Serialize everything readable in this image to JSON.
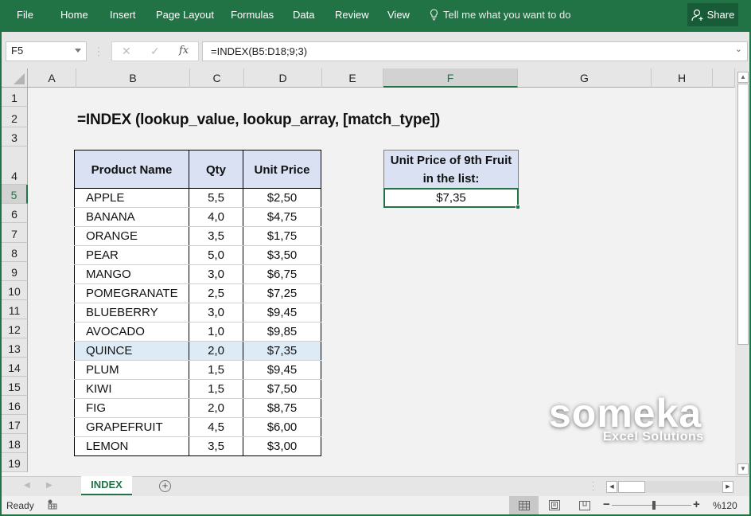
{
  "ribbon": {
    "tabs": [
      "File",
      "Home",
      "Insert",
      "Page Layout",
      "Formulas",
      "Data",
      "Review",
      "View"
    ],
    "tell_me": "Tell me what you want to do",
    "share": "Share"
  },
  "formula_bar": {
    "name_box": "F5",
    "formula": "=INDEX(B5:D18;9;3)"
  },
  "columns": [
    "A",
    "B",
    "C",
    "D",
    "E",
    "F",
    "G",
    "H"
  ],
  "selected_column": "F",
  "rows": [
    "1",
    "2",
    "3",
    "4",
    "5",
    "6",
    "7",
    "8",
    "9",
    "10",
    "11",
    "12",
    "13",
    "14",
    "15",
    "16",
    "17",
    "18",
    "19"
  ],
  "selected_row": "5",
  "sheet": {
    "title": "=INDEX (lookup_value, lookup_array, [match_type])",
    "table": {
      "headers": [
        "Product Name",
        "Qty",
        "Unit Price"
      ],
      "rows": [
        {
          "name": "APPLE",
          "qty": "5,5",
          "price": "$2,50"
        },
        {
          "name": "BANANA",
          "qty": "4,0",
          "price": "$4,75"
        },
        {
          "name": "ORANGE",
          "qty": "3,5",
          "price": "$1,75"
        },
        {
          "name": "PEAR",
          "qty": "5,0",
          "price": "$3,50"
        },
        {
          "name": "MANGO",
          "qty": "3,0",
          "price": "$6,75"
        },
        {
          "name": "POMEGRANATE",
          "qty": "2,5",
          "price": "$7,25"
        },
        {
          "name": "BLUEBERRY",
          "qty": "3,0",
          "price": "$9,45"
        },
        {
          "name": "AVOCADO",
          "qty": "1,0",
          "price": "$9,85"
        },
        {
          "name": "QUINCE",
          "qty": "2,0",
          "price": "$7,35",
          "highlighted": true
        },
        {
          "name": "PLUM",
          "qty": "1,5",
          "price": "$9,45"
        },
        {
          "name": "KIWI",
          "qty": "1,5",
          "price": "$7,50"
        },
        {
          "name": "FIG",
          "qty": "2,0",
          "price": "$8,75"
        },
        {
          "name": "GRAPEFRUIT",
          "qty": "4,5",
          "price": "$6,00"
        },
        {
          "name": "LEMON",
          "qty": "3,5",
          "price": "$3,00"
        }
      ]
    },
    "result": {
      "label_line1": "Unit Price of 9th Fruit",
      "label_line2": "in the list:",
      "value": "$7,35"
    },
    "logo": {
      "brand": "someka",
      "tagline": "Excel Solutions"
    }
  },
  "sheet_tabs": {
    "active": "INDEX"
  },
  "status_bar": {
    "ready": "Ready",
    "zoom": "%120"
  },
  "colors": {
    "accent": "#217346",
    "header_fill": "#d9e1f2",
    "highlight_fill": "#ddebf7"
  }
}
